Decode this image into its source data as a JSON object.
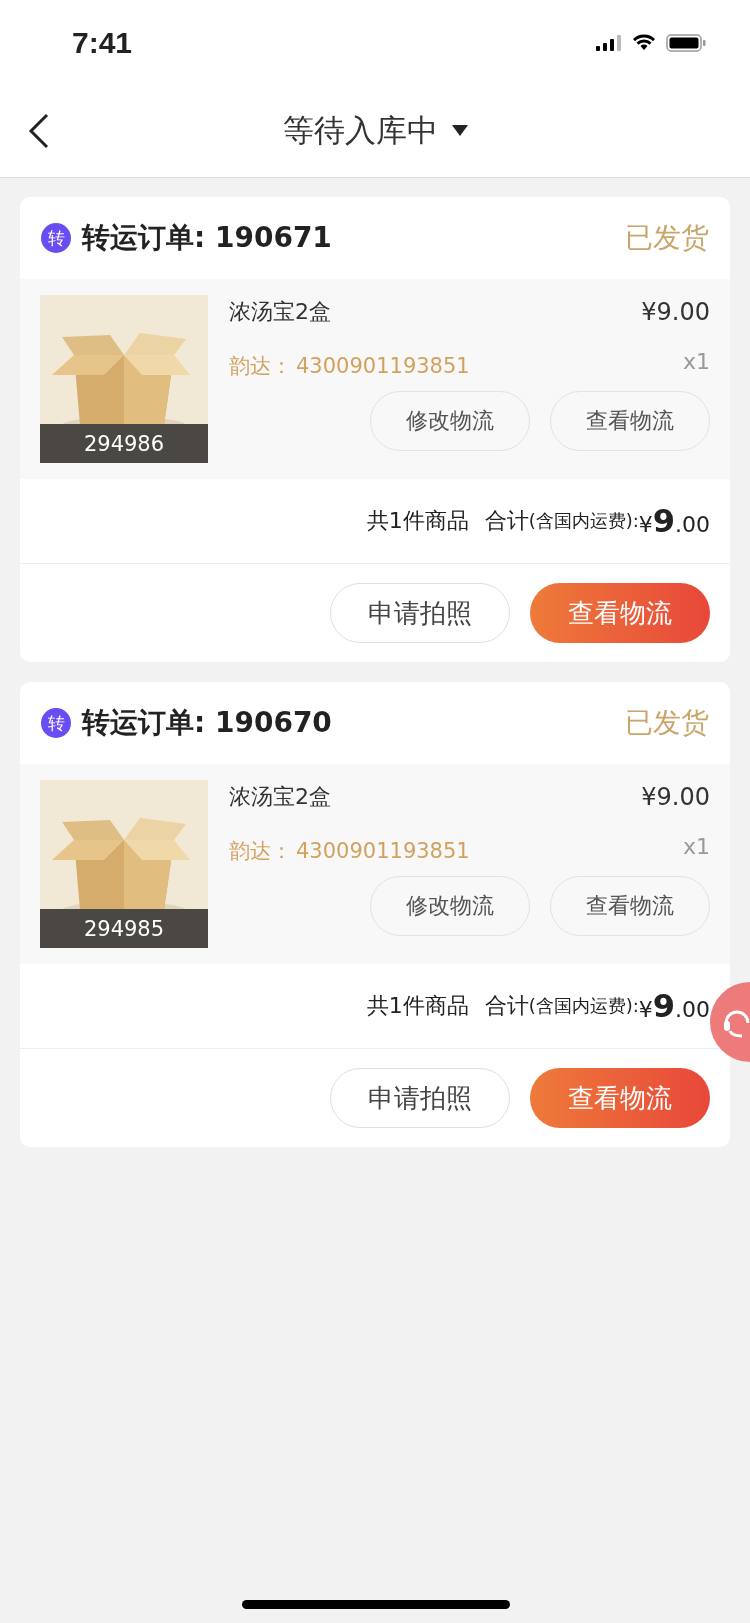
{
  "status_bar": {
    "time": "7:41"
  },
  "nav": {
    "title": "等待入库中"
  },
  "orders": [
    {
      "badge": "转",
      "title": "转运订单: 190671",
      "status": "已发货",
      "item": {
        "name": "浓汤宝2盒",
        "code": "294986",
        "price": "¥9.00",
        "courier": "韵达：",
        "tracking": "4300901193851",
        "qty": "x1",
        "actions": [
          "修改物流",
          "查看物流"
        ]
      },
      "count": "共1件商品",
      "total_label": "合计",
      "total_note": "(含国内运费):",
      "amount": "¥**9**.00",
      "buttons": [
        {
          "label": "申请拍照",
          "kind": "secondary"
        },
        {
          "label": "查看物流",
          "kind": "primary"
        }
      ]
    },
    {
      "badge": "转",
      "title": "转运订单: 190670",
      "status": "已发货",
      "item": {
        "name": "浓汤宝2盒",
        "code": "294985",
        "price": "¥9.00",
        "courier": "韵达：",
        "tracking": "4300901193851",
        "qty": "x1",
        "actions": [
          "修改物流",
          "查看物流"
        ]
      },
      "count": "共1件商品",
      "total_label": "合计",
      "total_note": "(含国内运费):",
      "amount": "¥**9**.00",
      "buttons": [
        {
          "label": "申请拍照",
          "kind": "secondary"
        },
        {
          "label": "查看物流",
          "kind": "primary"
        }
      ]
    }
  ]
}
